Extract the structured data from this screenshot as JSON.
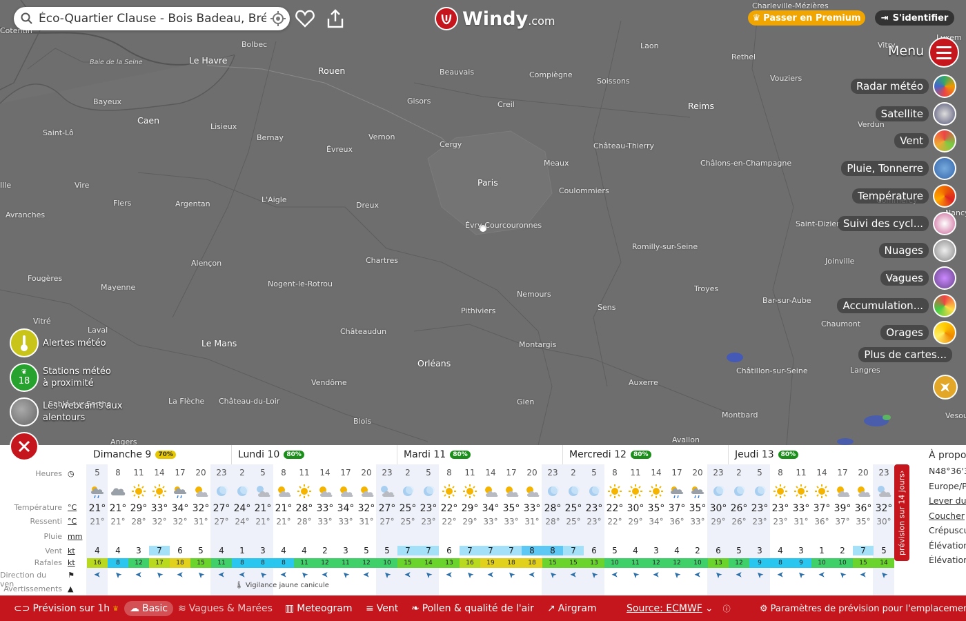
{
  "search": {
    "value": "Éco-Quartier Clause - Bois Badeau, Brétigny-sur-Orge"
  },
  "logo": {
    "name": "Windy",
    "suffix": ".com"
  },
  "top": {
    "premium": "Passer en Premium",
    "login": "S'identifier",
    "menu": "Menu"
  },
  "layers": [
    "Radar météo",
    "Satellite",
    "Vent",
    "Pluie, Tonnerre",
    "Température",
    "Suivi des cycl...",
    "Nuages",
    "Vagues",
    "Accumulation...",
    "Orages",
    "Plus de cartes..."
  ],
  "left": {
    "alerts": "Alertes météo",
    "stations_count": "18",
    "stations": "Stations météo à proximité",
    "webcams": "Les webcams aux alentours"
  },
  "map_labels": {
    "cities": [
      "Cotentin",
      "Bolbec",
      "Le Havre",
      "Rouen",
      "Beauvais",
      "Compiègne",
      "Laon",
      "Soissons",
      "Rethel",
      "Vouziers",
      "Charleville-Mézières",
      "Vitry",
      "Luxem",
      "Bayeux",
      "Caen",
      "Lisieux",
      "Bernay",
      "Gisors",
      "Creil",
      "Reims",
      "Verdun",
      "Saint-Lô",
      "Évreux",
      "Vernon",
      "Cergy",
      "Château-Thierry",
      "Meaux",
      "Châlons-en-Champagne",
      "Paris",
      "Coulommiers",
      "Vire",
      "Flers",
      "Argentan",
      "L'Aigle",
      "Dreux",
      "Évry-Courcouronnes",
      "Saint-Dizier",
      "Commercy",
      "Avranches",
      "Romilly-sur-Seine",
      "Joinville",
      "Alençon",
      "Chartres",
      "Fougères",
      "Mayenne",
      "Nogent-le-Rotrou",
      "Nemours",
      "Troyes",
      "Sens",
      "Bar-sur-Aube",
      "Pithiviers",
      "Nancy",
      "Vitré",
      "Laval",
      "Châteaudun",
      "Chaumont",
      "Le Mans",
      "Montargis",
      "Orléans",
      "Châtillon-sur-Seine",
      "Sablé-sur-Sarthe",
      "Vendôme",
      "Auxerre",
      "Langres",
      "La Flèche",
      "Château-du-Loir",
      "Gien",
      "Blois",
      "Montbard",
      "Avallon",
      "Angers",
      "Vesoul",
      "Ille",
      "Nancy"
    ],
    "baie": "Baie de la Seine",
    "cotentin": "Cotentin"
  },
  "forecast": {
    "row_labels": {
      "hours": "Heures",
      "temp": "Température",
      "feel": "Ressenti",
      "rain": "Pluie",
      "wind": "Vent",
      "gust": "Rafales",
      "dir": "Direction du ven",
      "warn": "Avertissements"
    },
    "units": {
      "temp": "°C",
      "feel": "°C",
      "rain": "mm",
      "wind": "kt",
      "gust": "kt"
    },
    "days": [
      {
        "name": "Dimanche 9",
        "prob": "70%",
        "hours": [
          "5",
          "8",
          "11",
          "14",
          "17",
          "20",
          "23"
        ],
        "temp": [
          "21°",
          "21°",
          "29°",
          "33°",
          "34°",
          "32°",
          "27°"
        ],
        "feel": [
          "21°",
          "21°",
          "28°",
          "32°",
          "32°",
          "31°",
          "27°"
        ],
        "wind": [
          "4",
          "4",
          "3",
          "7",
          "6",
          "5",
          "4"
        ],
        "gust": [
          "16",
          "8",
          "12",
          "17",
          "18",
          "15",
          "11"
        ],
        "wx": [
          "rain-cloud",
          "cloud",
          "sun",
          "sun",
          "rain-cloud",
          "sun-cloud",
          "moon"
        ]
      },
      {
        "name": "Lundi 10",
        "prob": "80%",
        "hours": [
          "2",
          "5",
          "8",
          "11",
          "14",
          "17",
          "20",
          "23"
        ],
        "temp": [
          "24°",
          "21°",
          "21°",
          "28°",
          "33°",
          "34°",
          "32°",
          "27°"
        ],
        "feel": [
          "24°",
          "21°",
          "21°",
          "28°",
          "33°",
          "33°",
          "31°",
          "27°"
        ],
        "wind": [
          "1",
          "3",
          "4",
          "4",
          "2",
          "3",
          "5",
          "5"
        ],
        "gust": [
          "8",
          "8",
          "8",
          "11",
          "12",
          "11",
          "12",
          "10"
        ],
        "wx": [
          "moon",
          "moon-cloud",
          "sun-cloud",
          "sun",
          "sun-cloud",
          "sun-cloud",
          "sun-cloud",
          "moon-cloud"
        ]
      },
      {
        "name": "Mardi 11",
        "prob": "80%",
        "hours": [
          "2",
          "5",
          "8",
          "11",
          "14",
          "17",
          "20",
          "23"
        ],
        "temp": [
          "25°",
          "23°",
          "22°",
          "29°",
          "34°",
          "35°",
          "33°",
          "28°"
        ],
        "feel": [
          "25°",
          "23°",
          "22°",
          "29°",
          "33°",
          "33°",
          "31°",
          "28°"
        ],
        "wind": [
          "7",
          "7",
          "6",
          "7",
          "7",
          "7",
          "8",
          "8"
        ],
        "gust": [
          "15",
          "14",
          "13",
          "16",
          "19",
          "18",
          "18",
          "15"
        ],
        "wx": [
          "moon",
          "moon",
          "sun",
          "sun",
          "sun-cloud",
          "sun-cloud",
          "sun-cloud",
          "moon"
        ]
      },
      {
        "name": "Mercredi 12",
        "prob": "80%",
        "hours": [
          "2",
          "5",
          "8",
          "11",
          "14",
          "17",
          "20",
          "23"
        ],
        "temp": [
          "25°",
          "23°",
          "22°",
          "30°",
          "35°",
          "37°",
          "35°",
          "30°"
        ],
        "feel": [
          "25°",
          "23°",
          "22°",
          "29°",
          "34°",
          "36°",
          "33°",
          "29°"
        ],
        "wind": [
          "7",
          "6",
          "5",
          "4",
          "3",
          "4",
          "2",
          "6"
        ],
        "gust": [
          "15",
          "13",
          "10",
          "11",
          "12",
          "12",
          "10",
          "13"
        ],
        "wx": [
          "moon",
          "moon",
          "sun",
          "sun",
          "sun",
          "rain-cloud",
          "rain-cloud",
          "moon"
        ]
      },
      {
        "name": "Jeudi 13",
        "prob": "80%",
        "hours": [
          "2",
          "5",
          "8",
          "11",
          "14",
          "17",
          "20",
          "23"
        ],
        "temp": [
          "26°",
          "23°",
          "23°",
          "33°",
          "37°",
          "39°",
          "36°",
          "32°"
        ],
        "feel": [
          "26°",
          "23°",
          "23°",
          "31°",
          "36°",
          "37°",
          "35°",
          "30°"
        ],
        "wind": [
          "5",
          "3",
          "4",
          "3",
          "1",
          "2",
          "7",
          "5"
        ],
        "gust": [
          "12",
          "9",
          "8",
          "9",
          "10",
          "10",
          "15",
          "14"
        ],
        "wx": [
          "moon",
          "moon",
          "sun",
          "sun",
          "sun",
          "sun-cloud",
          "sun-cloud",
          "moon-cloud"
        ]
      }
    ],
    "alert_text": "Vigilance jaune canicule",
    "side_tab": "prévision sur 14 jours",
    "side_info": [
      "À propos",
      "N48°36'3",
      "Europe/P",
      "Lever du",
      "Coucher",
      "Crépuscu",
      "Élévation",
      "Élévation"
    ]
  },
  "bottom": {
    "forecast1h": "Prévision sur 1h",
    "basic": "Basic",
    "waves": "Vagues & Marées",
    "meteogram": "Meteogram",
    "wind": "Vent",
    "pollen": "Pollen & qualité de l'air",
    "airgram": "Airgram",
    "source": "Source: ECMWF",
    "settings": "Paramètres de prévision pour l'emplacement"
  },
  "colors": {
    "brand": "#c4161c",
    "premium": "#f0a500",
    "map": "#6e6e6e"
  }
}
